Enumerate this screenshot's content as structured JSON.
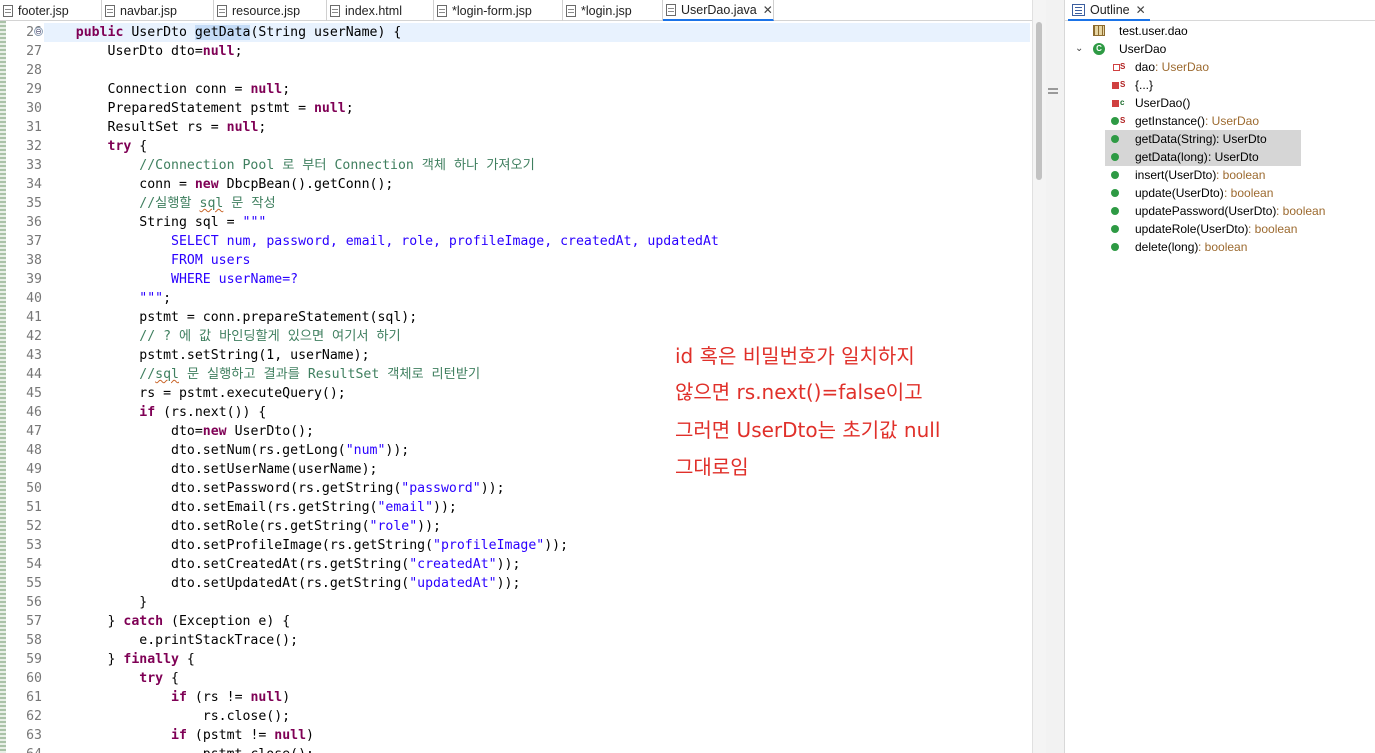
{
  "tabs": [
    {
      "label": "footer.jsp",
      "active": false
    },
    {
      "label": "navbar.jsp",
      "active": false
    },
    {
      "label": "resource.jsp",
      "active": false
    },
    {
      "label": "index.html",
      "active": false
    },
    {
      "label": "*login-form.jsp",
      "active": false
    },
    {
      "label": "*login.jsp",
      "active": false
    },
    {
      "label": "UserDao.java",
      "active": true
    }
  ],
  "tab_close_glyph": "✕",
  "fold_glyph": "⊖",
  "editor": {
    "lines": [
      {
        "n": "26",
        "segs": [
          [
            "",
            "    "
          ],
          [
            "kw",
            "public"
          ],
          [
            "",
            " UserDto "
          ],
          [
            "sel",
            "getData"
          ],
          [
            "",
            "(String userName) {"
          ]
        ],
        "current": true
      },
      {
        "n": "27",
        "segs": [
          [
            "",
            "        UserDto dto="
          ],
          [
            "kw",
            "null"
          ],
          [
            "",
            ";"
          ]
        ]
      },
      {
        "n": "28",
        "segs": [
          [
            "",
            ""
          ]
        ]
      },
      {
        "n": "29",
        "segs": [
          [
            "",
            "        Connection conn = "
          ],
          [
            "kw",
            "null"
          ],
          [
            "",
            ";"
          ]
        ]
      },
      {
        "n": "30",
        "segs": [
          [
            "",
            "        PreparedStatement pstmt = "
          ],
          [
            "kw",
            "null"
          ],
          [
            "",
            ";"
          ]
        ]
      },
      {
        "n": "31",
        "segs": [
          [
            "",
            "        ResultSet rs = "
          ],
          [
            "kw",
            "null"
          ],
          [
            "",
            ";"
          ]
        ]
      },
      {
        "n": "32",
        "segs": [
          [
            "",
            "        "
          ],
          [
            "kw",
            "try"
          ],
          [
            "",
            " {"
          ]
        ]
      },
      {
        "n": "33",
        "segs": [
          [
            "",
            "            "
          ],
          [
            "cm",
            "//Connection Pool 로 부터 Connection 객체 하나 가져오기"
          ]
        ]
      },
      {
        "n": "34",
        "segs": [
          [
            "",
            "            conn = "
          ],
          [
            "kw",
            "new"
          ],
          [
            "",
            " DbcpBean().getConn();"
          ]
        ]
      },
      {
        "n": "35",
        "segs": [
          [
            "",
            "            "
          ],
          [
            "cm",
            "//실행할 "
          ],
          [
            "cm sq",
            "sql"
          ],
          [
            "cm",
            " 문 작성"
          ]
        ]
      },
      {
        "n": "36",
        "segs": [
          [
            "",
            "            String sql = "
          ],
          [
            "str",
            "\"\"\""
          ]
        ]
      },
      {
        "n": "37",
        "segs": [
          [
            "",
            "                "
          ],
          [
            "tb",
            "SELECT num, password, email, role, profileImage, createdAt, updatedAt"
          ]
        ]
      },
      {
        "n": "38",
        "segs": [
          [
            "",
            "                "
          ],
          [
            "tb",
            "FROM users"
          ]
        ]
      },
      {
        "n": "39",
        "segs": [
          [
            "",
            "                "
          ],
          [
            "tb",
            "WHERE userName=?"
          ]
        ]
      },
      {
        "n": "40",
        "segs": [
          [
            "",
            "            "
          ],
          [
            "str",
            "\"\"\""
          ],
          [
            "",
            ";"
          ]
        ]
      },
      {
        "n": "41",
        "segs": [
          [
            "",
            "            pstmt = conn.prepareStatement(sql);"
          ]
        ]
      },
      {
        "n": "42",
        "segs": [
          [
            "",
            "            "
          ],
          [
            "cm",
            "// ? 에 값 바인딩할게 있으면 여기서 하기"
          ]
        ]
      },
      {
        "n": "43",
        "segs": [
          [
            "",
            "            pstmt.setString(1, userName);"
          ]
        ]
      },
      {
        "n": "44",
        "segs": [
          [
            "",
            "            "
          ],
          [
            "cm",
            "//"
          ],
          [
            "cm sq",
            "sql"
          ],
          [
            "cm",
            " 문 실행하고 결과를 ResultSet 객체로 리턴받기"
          ]
        ]
      },
      {
        "n": "45",
        "segs": [
          [
            "",
            "            rs = pstmt.executeQuery();"
          ]
        ]
      },
      {
        "n": "46",
        "segs": [
          [
            "",
            "            "
          ],
          [
            "kw",
            "if"
          ],
          [
            "",
            " (rs.next()) {"
          ]
        ]
      },
      {
        "n": "47",
        "segs": [
          [
            "",
            "                dto="
          ],
          [
            "kw",
            "new"
          ],
          [
            "",
            " UserDto();"
          ]
        ]
      },
      {
        "n": "48",
        "segs": [
          [
            "",
            "                dto.setNum(rs.getLong("
          ],
          [
            "str",
            "\"num\""
          ],
          [
            "",
            "));"
          ]
        ]
      },
      {
        "n": "49",
        "segs": [
          [
            "",
            "                dto.setUserName(userName);"
          ]
        ]
      },
      {
        "n": "50",
        "segs": [
          [
            "",
            "                dto.setPassword(rs.getString("
          ],
          [
            "str",
            "\"password\""
          ],
          [
            "",
            "));"
          ]
        ]
      },
      {
        "n": "51",
        "segs": [
          [
            "",
            "                dto.setEmail(rs.getString("
          ],
          [
            "str",
            "\"email\""
          ],
          [
            "",
            "));"
          ]
        ]
      },
      {
        "n": "52",
        "segs": [
          [
            "",
            "                dto.setRole(rs.getString("
          ],
          [
            "str",
            "\"role\""
          ],
          [
            "",
            "));"
          ]
        ]
      },
      {
        "n": "53",
        "segs": [
          [
            "",
            "                dto.setProfileImage(rs.getString("
          ],
          [
            "str",
            "\"profileImage\""
          ],
          [
            "",
            "));"
          ]
        ]
      },
      {
        "n": "54",
        "segs": [
          [
            "",
            "                dto.setCreatedAt(rs.getString("
          ],
          [
            "str",
            "\"createdAt\""
          ],
          [
            "",
            "));"
          ]
        ]
      },
      {
        "n": "55",
        "segs": [
          [
            "",
            "                dto.setUpdatedAt(rs.getString("
          ],
          [
            "str",
            "\"updatedAt\""
          ],
          [
            "",
            "));"
          ]
        ]
      },
      {
        "n": "56",
        "segs": [
          [
            "",
            "            }"
          ]
        ]
      },
      {
        "n": "57",
        "segs": [
          [
            "",
            "        } "
          ],
          [
            "kw",
            "catch"
          ],
          [
            "",
            " (Exception e) {"
          ]
        ]
      },
      {
        "n": "58",
        "segs": [
          [
            "",
            "            e.printStackTrace();"
          ]
        ]
      },
      {
        "n": "59",
        "segs": [
          [
            "",
            "        } "
          ],
          [
            "kw",
            "finally"
          ],
          [
            "",
            " {"
          ]
        ]
      },
      {
        "n": "60",
        "segs": [
          [
            "",
            "            "
          ],
          [
            "kw",
            "try"
          ],
          [
            "",
            " {"
          ]
        ]
      },
      {
        "n": "61",
        "segs": [
          [
            "",
            "                "
          ],
          [
            "kw",
            "if"
          ],
          [
            "",
            " (rs != "
          ],
          [
            "kw",
            "null"
          ],
          [
            "",
            ")"
          ]
        ]
      },
      {
        "n": "62",
        "segs": [
          [
            "",
            "                    rs.close();"
          ]
        ]
      },
      {
        "n": "63",
        "segs": [
          [
            "",
            "                "
          ],
          [
            "kw",
            "if"
          ],
          [
            "",
            " (pstmt != "
          ],
          [
            "kw",
            "null"
          ],
          [
            "",
            ")"
          ]
        ]
      },
      {
        "n": "64",
        "segs": [
          [
            "",
            "                    pstmt.close();"
          ]
        ]
      }
    ]
  },
  "annotation": [
    "id 혹은 비밀번호가 일치하지",
    "않으면 rs.next()=false이고",
    "그러면 UserDto는 초기값 null",
    "그대로임"
  ],
  "outline": {
    "tab_label": "Outline",
    "package": "test.user.dao",
    "class_name": "UserDao",
    "expand_glyph": "⌄",
    "class_glyph": "C",
    "members": [
      {
        "name": "dao",
        "type": " : UserDao",
        "icon": "private-field",
        "mod": "S",
        "hl": false
      },
      {
        "name": "{...}",
        "type": "",
        "icon": "static-init",
        "mod": "S",
        "hl": false
      },
      {
        "name": "UserDao()",
        "type": "",
        "icon": "private-constructor",
        "mod": "c",
        "hl": false
      },
      {
        "name": "getInstance()",
        "type": " : UserDao",
        "icon": "public-method",
        "mod": "S",
        "hl": false
      },
      {
        "name": "getData(String)",
        "type": " : UserDto",
        "icon": "public-method",
        "mod": "",
        "hl": true
      },
      {
        "name": "getData(long)",
        "type": " : UserDto",
        "icon": "public-method",
        "mod": "",
        "hl": true
      },
      {
        "name": "insert(UserDto)",
        "type": " : boolean",
        "icon": "public-method",
        "mod": "",
        "hl": false
      },
      {
        "name": "update(UserDto)",
        "type": " : boolean",
        "icon": "public-method",
        "mod": "",
        "hl": false
      },
      {
        "name": "updatePassword(UserDto)",
        "type": " : boolean",
        "icon": "public-method",
        "mod": "",
        "hl": false
      },
      {
        "name": "updateRole(UserDto)",
        "type": " : boolean",
        "icon": "public-method",
        "mod": "",
        "hl": false
      },
      {
        "name": "delete(long)",
        "type": " : boolean",
        "icon": "public-method",
        "mod": "",
        "hl": false
      }
    ]
  },
  "colors": {
    "keyword": "#7f0055",
    "comment": "#3f7f5f",
    "string": "#2a00ff",
    "annotation": "#e0302a",
    "selection": "#c5dcf7",
    "current_line": "#e8f2fe",
    "outline_highlight": "#d6d6d6"
  }
}
